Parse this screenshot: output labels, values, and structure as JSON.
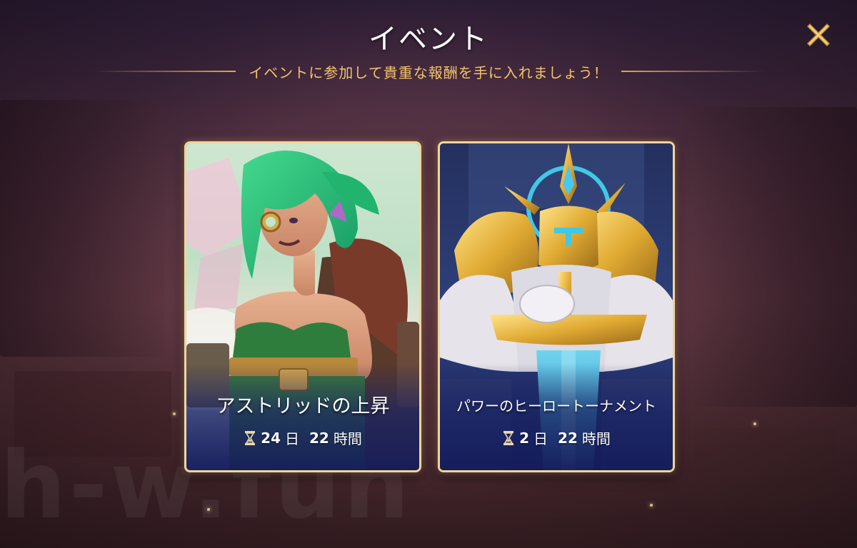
{
  "header": {
    "title": "イベント",
    "subtitle": "イベントに参加して貴重な報酬を手に入れましょう！"
  },
  "close_button": {
    "icon": "close-icon"
  },
  "events": [
    {
      "name": "アストリッドの上昇",
      "days": "24",
      "day_unit": "日",
      "hours": "22",
      "hour_unit": "時間",
      "icon": "hourglass-icon",
      "art": "astrid-hero-art"
    },
    {
      "name": "パワーのヒーロートーナメント",
      "days": "2",
      "day_unit": "日",
      "hours": "22",
      "hour_unit": "時間",
      "icon": "hourglass-icon",
      "art": "golden-knight-art"
    }
  ],
  "watermark": "h-w.fun",
  "colors": {
    "accent_gold": "#f2c46a",
    "card_border": "#f0d59c",
    "close_gold": "#f3d27a"
  }
}
